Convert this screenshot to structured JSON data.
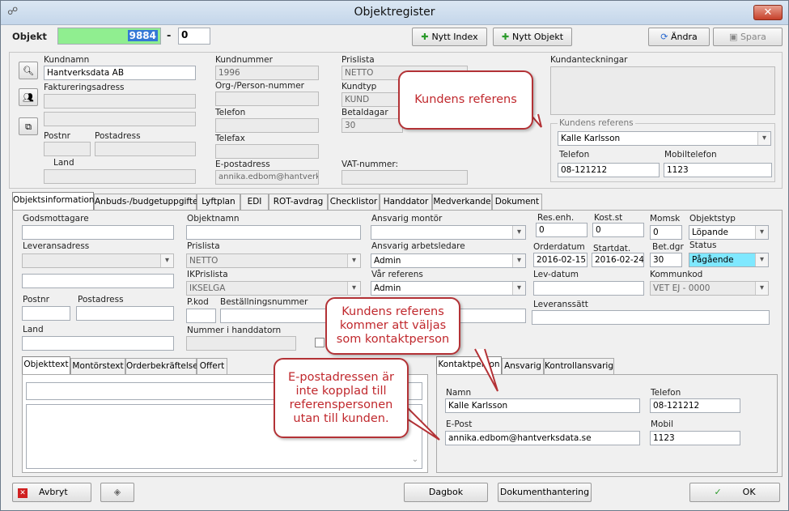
{
  "window": {
    "title": "Objektregister",
    "icon": "link-icon"
  },
  "header": {
    "objekt_label": "Objekt",
    "objekt_number": "9884",
    "dash": "-",
    "sub_number": "0",
    "buttons": {
      "nytt_index": "Nytt Index",
      "nytt_objekt": "Nytt Objekt",
      "andra": "Ändra",
      "spara": "Spara"
    }
  },
  "customer": {
    "kundnamn_label": "Kundnamn",
    "kundnamn": "Hantverksdata AB",
    "faktureringsadress_label": "Faktureringsadress",
    "postnr_label": "Postnr",
    "postadress_label": "Postadress",
    "land_label": "Land",
    "kundnummer_label": "Kundnummer",
    "kundnummer": "1996",
    "orgnr_label": "Org-/Person-nummer",
    "telefon_label": "Telefon",
    "telefax_label": "Telefax",
    "epost_label": "E-postadress",
    "epost": "annika.edbom@hantverks",
    "prislista_label": "Prislista",
    "prislista": "NETTO",
    "kundtyp_label": "Kundtyp",
    "kundtyp": "KUND",
    "betaldagar_label": "Betaldagar",
    "betaldagar": "30",
    "vat_label": "VAT-nummer:",
    "kundanteckningar_label": "Kundanteckningar",
    "ref_group_label": "Kundens referens",
    "ref_value": "Kalle Karlsson",
    "ref_telefon_label": "Telefon",
    "ref_telefon": "08-121212",
    "ref_mobil_label": "Mobiltelefon",
    "ref_mobil": "1123"
  },
  "main_tabs": [
    "Objektsinformation",
    "Anbuds-/budgetuppgifter",
    "Lyftplan",
    "EDI",
    "ROT-avdrag",
    "Checklistor",
    "Handdator",
    "Medverkande",
    "Dokument"
  ],
  "objinfo": {
    "godsmottagare_label": "Godsmottagare",
    "leveransadress_label": "Leveransadress",
    "postnr_label": "Postnr",
    "postadress_label": "Postadress",
    "land_label": "Land",
    "objektnamn_label": "Objektnamn",
    "prislista_label": "Prislista",
    "prislista": "NETTO",
    "ikprislista_label": "IKPrislista",
    "ikprislista": "IKSELGA",
    "pkod_label": "P.kod",
    "bestallningsnummer_label": "Beställningsnummer",
    "nummer_handdator_label": "Nummer i handdatorn",
    "ansvarig_montor_label": "Ansvarig montör",
    "ansvarig_arbetsledare_label": "Ansvarig arbetsledare",
    "ansvarig_arbetsledare": "Admin",
    "var_referens_label": "Vår referens",
    "var_referens": "Admin",
    "res_enh_label": "Res.enh.",
    "res_enh": "0",
    "kost_st_label": "Kost.st",
    "kost_st": "0",
    "momsk_label": "Momsk",
    "momsk": "0",
    "objektstyp_label": "Objektstyp",
    "objektstyp": "Löpande",
    "orderdatum_label": "Orderdatum",
    "orderdatum": "2016-02-15",
    "startdat_label": "Startdat.",
    "startdat": "2016-02-24",
    "betdgr_label": "Bet.dgr",
    "betdgr": "30",
    "status_label": "Status",
    "status": "Pågående",
    "levdatum_label": "Lev-datum",
    "kommunkod_label": "Kommunkod",
    "kommunkod": "VET EJ - 0000",
    "leveranssatt_label": "Leveranssätt"
  },
  "text_tabs": [
    "Objekttext",
    "Montörstext",
    "Orderbekräftelse",
    "Offert"
  ],
  "contact_tabs": [
    "Kontaktperson",
    "Ansvarig",
    "Kontrollansvarig"
  ],
  "contact": {
    "namn_label": "Namn",
    "namn": "Kalle Karlsson",
    "telefon_label": "Telefon",
    "telefon": "08-121212",
    "epost_label": "E-Post",
    "epost": "annika.edbom@hantverksdata.se",
    "mobil_label": "Mobil",
    "mobil": "1123"
  },
  "callouts": {
    "c1": "Kundens referens",
    "c2": "Kundens referens kommer att väljas som kontaktperson",
    "c3": "E-postadressen är inte kopplad till referenspersonen utan till kunden."
  },
  "footer": {
    "avbryt": "Avbryt",
    "dagbok": "Dagbok",
    "dokumenthantering": "Dokumenthantering",
    "ok": "OK"
  },
  "colors": {
    "objekt_field": "#90ee90",
    "status_field": "#7fe8ff",
    "callout_border": "#b33236",
    "callout_text": "#c0282d"
  }
}
